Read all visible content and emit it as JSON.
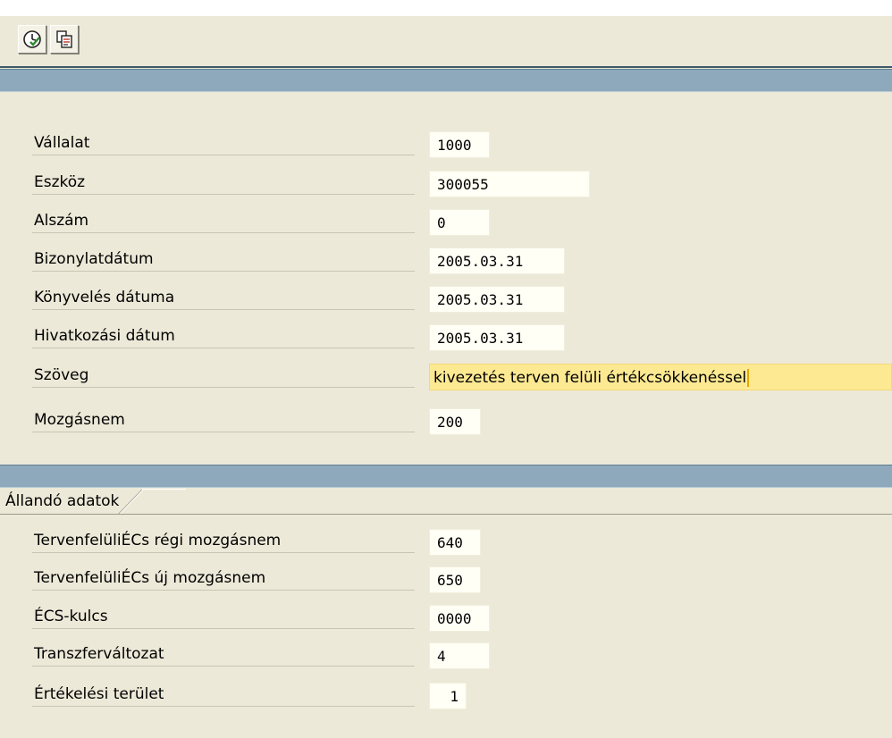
{
  "toolbar": {
    "buttons": [
      {
        "name": "execute-clock-icon"
      },
      {
        "name": "copy-documents-icon"
      }
    ]
  },
  "header_fields": [
    {
      "label": "Vállalat",
      "value": "1000"
    },
    {
      "label": "Eszköz",
      "value": "300055"
    },
    {
      "label": "Alszám",
      "value": "0"
    },
    {
      "label": "Bizonylatdátum",
      "value": "2005.03.31"
    },
    {
      "label": "Könyvelés dátuma",
      "value": "2005.03.31"
    },
    {
      "label": "Hivatkozási dátum",
      "value": "2005.03.31"
    },
    {
      "label": "Szöveg",
      "value": "kivezetés terven felüli értékcsökkenéssel"
    },
    {
      "label": "Mozgásnem",
      "value": "200"
    }
  ],
  "tab": {
    "label": "Állandó adatok"
  },
  "fixed_fields": [
    {
      "label": "TervenfelüliÉCs régi mozgásnem",
      "value": "640"
    },
    {
      "label": "TervenfelüliÉCs új mozgásnem",
      "value": "650"
    },
    {
      "label": "ÉCS-kulcs",
      "value": "0000"
    },
    {
      "label": "Transzferváltozat",
      "value": "4"
    },
    {
      "label": "Értékelési terület",
      "value": "1"
    }
  ],
  "colors": {
    "background": "#ece9d8",
    "band": "#8da9bb",
    "field": "#fffff6",
    "active_field": "#fde992"
  }
}
